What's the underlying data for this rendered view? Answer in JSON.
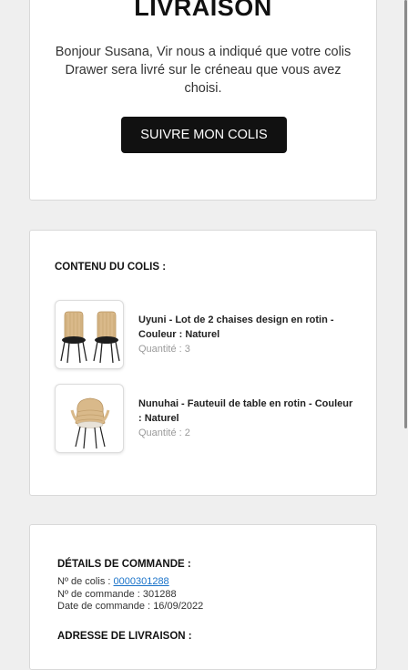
{
  "banner": {
    "headline": "LIVRAISON",
    "greeting": "Bonjour Susana, Vir nous a indiqué que votre colis Drawer sera livré sur le créneau que vous avez choisi.",
    "track_button_label": "SUIVRE MON COLIS"
  },
  "parcel": {
    "section_title": "CONTENU DU COLIS :",
    "quantity_label": "Quantité :",
    "items": [
      {
        "name": "Uyuni - Lot de 2 chaises design en rotin - Couleur : Naturel",
        "quantity": "3",
        "image_icon": "rattan-chairs-pair-icon"
      },
      {
        "name": "Nunuhai - Fauteuil de table en rotin - Couleur : Naturel",
        "quantity": "2",
        "image_icon": "rattan-armchair-icon"
      }
    ]
  },
  "order": {
    "section_title": "DÉTAILS DE COMMANDE :",
    "parcel_number_label": "Nº de colis :",
    "parcel_number": "0000301288",
    "order_number_label": "Nº de commande :",
    "order_number": "301288",
    "order_date_label": "Date de commande :",
    "order_date": "16/09/2022"
  },
  "address": {
    "section_title": "ADRESSE DE LIVRAISON :"
  },
  "colors": {
    "button_bg": "#111111",
    "link": "#1a73c9",
    "page_bg": "#efefef",
    "rattan": "#d9b98a"
  }
}
